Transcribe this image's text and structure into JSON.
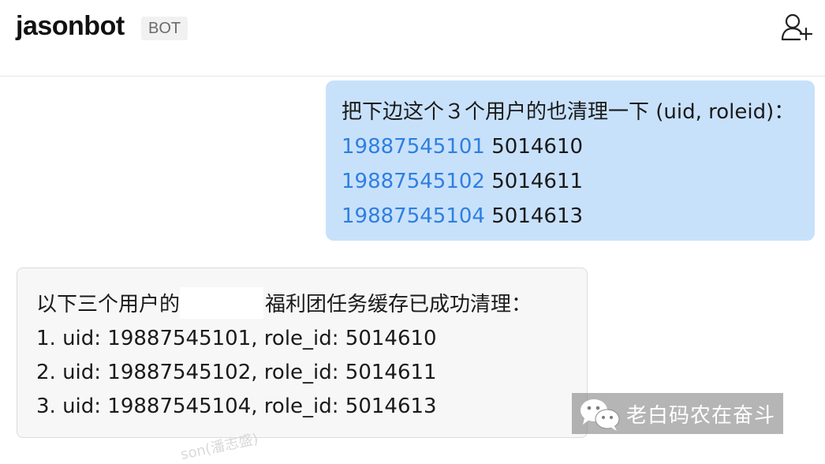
{
  "header": {
    "title": "jasonbot",
    "badge": "BOT",
    "add_user_icon": "add-user-icon"
  },
  "user_message": {
    "intro": "把下边这个３个用户的也清理一下 (uid, roleid)：",
    "rows": [
      {
        "uid": "19887545101",
        "roleid": "5014610"
      },
      {
        "uid": "19887545102",
        "roleid": "5014611"
      },
      {
        "uid": "19887545104",
        "roleid": "5014613"
      }
    ]
  },
  "bot_message": {
    "intro_before": "以下三个用户的",
    "intro_after": "福利团任务缓存已成功清理：",
    "items": [
      "1. uid: 19887545101, role_id: 5014610",
      "2. uid: 19887545102, role_id: 5014611",
      "3. uid: 19887545104, role_id: 5014613"
    ]
  },
  "watermark": {
    "faint_text": "son(潘志盛)",
    "text": "老白码农在奋斗",
    "logo_icon": "wechat-logo-icon"
  },
  "colors": {
    "user_bubble": "#c8e1fb",
    "link": "#2f7fe0",
    "bot_bubble": "#f7f7f7"
  }
}
